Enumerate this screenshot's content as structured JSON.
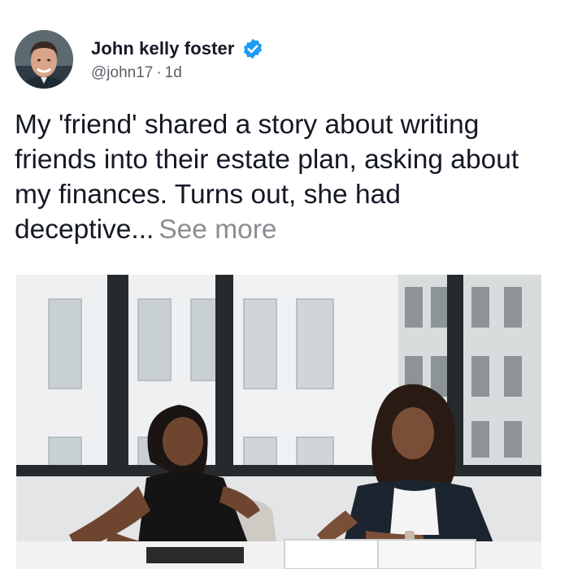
{
  "post": {
    "author_name": "John kelly foster",
    "verified_icon": "verified-badge-icon",
    "handle": "@john17",
    "separator": "·",
    "time_ago": "1d",
    "text": "My 'friend' shared a story about writing friends into their estate plan, asking about my finances. Turns out, she had deceptive...",
    "see_more_label": "See more",
    "photo_icon": "photo-two-women-meeting"
  },
  "colors": {
    "verified_blue": "#1d9bf0",
    "text": "#141823",
    "secondary_text": "#5b6068",
    "see_more": "#8a8d91"
  }
}
